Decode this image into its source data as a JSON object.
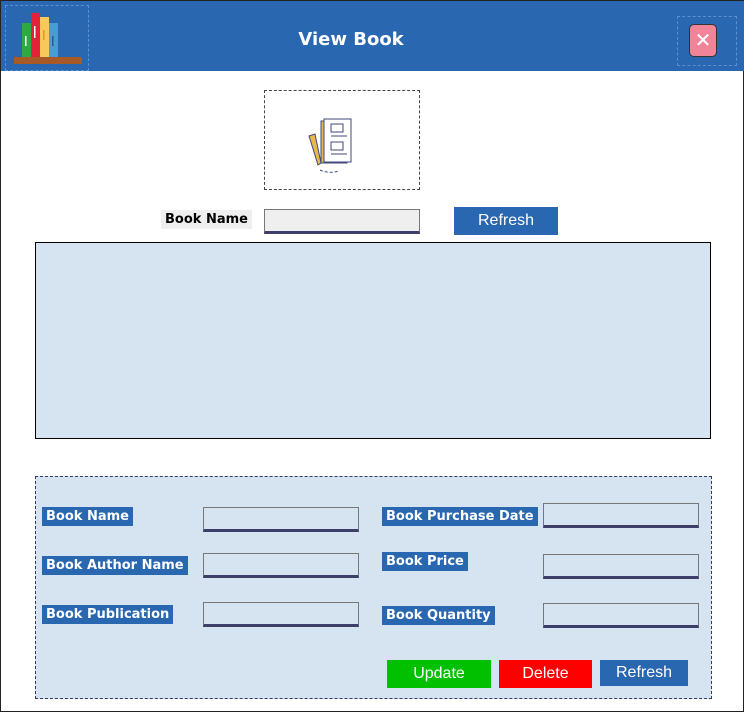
{
  "header": {
    "title": "View Book",
    "logo_icon": "bookshelf-icon",
    "close_icon": "close-icon"
  },
  "search": {
    "label": "Book Name",
    "value": "",
    "refresh_label": "Refresh"
  },
  "form": {
    "book_name_label": "Book Name",
    "author_label": "Book Author Name",
    "publication_label": "Book Publication",
    "purchase_date_label": "Book Purchase Date",
    "price_label": "Book Price",
    "quantity_label": "Book Quantity",
    "update_label": "Update",
    "delete_label": "Delete",
    "refresh_label": "Refresh"
  },
  "colors": {
    "brand": "#2a67b1",
    "panel": "#d6e4f1",
    "update": "#00c000",
    "delete": "#ff0000",
    "close": "#f08599"
  }
}
